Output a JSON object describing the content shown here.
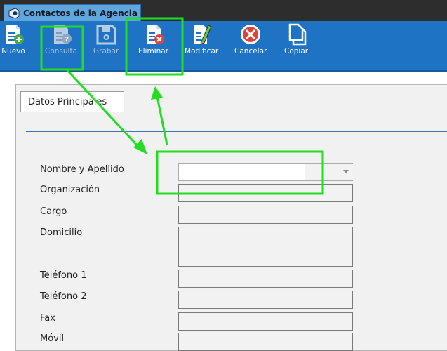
{
  "window": {
    "title": "Contactos de la Agencia"
  },
  "toolbar": {
    "buttons": [
      {
        "label": "Nuevo",
        "icon": "new-document-icon",
        "enabled": true
      },
      {
        "label": "Consulta",
        "icon": "query-document-icon",
        "enabled": false
      },
      {
        "label": "Grabar",
        "icon": "save-icon",
        "enabled": false
      },
      {
        "label": "Eliminar",
        "icon": "delete-document-icon",
        "enabled": true
      },
      {
        "label": "Modificar",
        "icon": "edit-document-icon",
        "enabled": true
      },
      {
        "label": "Cancelar",
        "icon": "cancel-icon",
        "enabled": true
      },
      {
        "label": "Copiar",
        "icon": "copy-icon",
        "enabled": true
      }
    ]
  },
  "form": {
    "tab_label": "Datos Principales",
    "fields": [
      {
        "label": "Nombre y Apellido",
        "value": "",
        "type": "select"
      },
      {
        "label": "Organización",
        "value": ""
      },
      {
        "label": "Cargo",
        "value": ""
      },
      {
        "label": "Domicilio",
        "value": ""
      },
      {
        "label": "Teléfono 1",
        "value": ""
      },
      {
        "label": "Teléfono 2",
        "value": ""
      },
      {
        "label": "Fax",
        "value": ""
      },
      {
        "label": "Móvil",
        "value": ""
      }
    ]
  },
  "annotations": {
    "highlight_color": "#22dd22"
  },
  "colors": {
    "toolbar": "#1f73c5",
    "tab": "#5fa6dd",
    "titlebar": "#2d2d2d"
  }
}
